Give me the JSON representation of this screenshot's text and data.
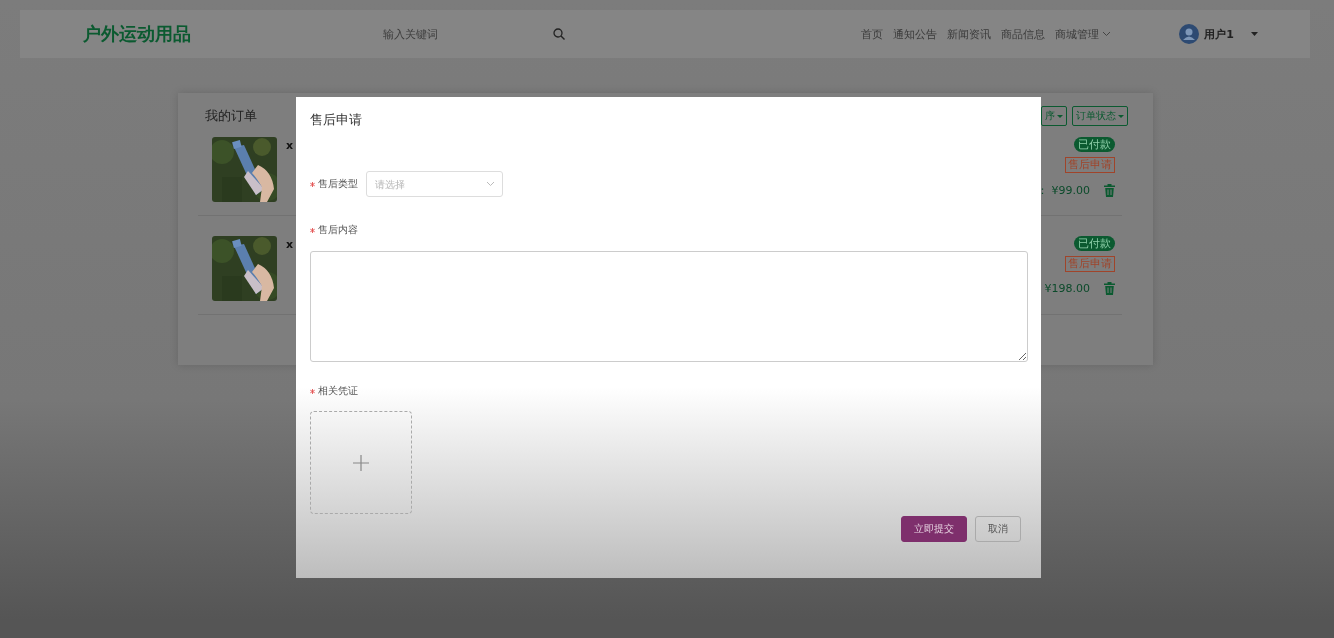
{
  "header": {
    "logo": "户外运动用品",
    "search": {
      "placeholder": "输入关键词"
    },
    "nav": [
      {
        "label": "首页",
        "dropdown": false
      },
      {
        "label": "通知公告",
        "dropdown": false
      },
      {
        "label": "新闻资讯",
        "dropdown": false
      },
      {
        "label": "商品信息",
        "dropdown": false
      },
      {
        "label": "商城管理",
        "dropdown": true
      }
    ],
    "user": {
      "name": "用户1"
    }
  },
  "orders": {
    "title": "我的订单",
    "filters": [
      {
        "label": "序"
      },
      {
        "label": "订单状态"
      }
    ],
    "rows": [
      {
        "title": "x",
        "status": "已付款",
        "action": "售后申请",
        "price": "： ¥99.00"
      },
      {
        "title": "x",
        "status": "已付款",
        "action": "售后申请",
        "price": "¥198.00"
      }
    ]
  },
  "dialog": {
    "title": "售后申请",
    "fields": [
      {
        "kind": "select",
        "label": "售后类型",
        "required": true,
        "placeholder": "请选择"
      },
      {
        "kind": "textarea",
        "label": "售后内容",
        "required": true
      },
      {
        "kind": "upload",
        "label": "相关凭证",
        "required": true
      }
    ],
    "buttons": [
      {
        "kind": "primary",
        "label": "立即提交"
      },
      {
        "kind": "default",
        "label": "取消"
      }
    ]
  }
}
